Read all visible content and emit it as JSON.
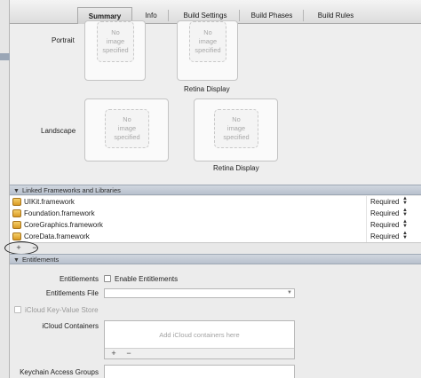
{
  "tabs": [
    {
      "label": "Summary",
      "active": true
    },
    {
      "label": "Info",
      "active": false
    },
    {
      "label": "Build Settings",
      "active": false
    },
    {
      "label": "Build Phases",
      "active": false
    },
    {
      "label": "Build Rules",
      "active": false
    }
  ],
  "launch_images": {
    "portrait_label": "Portrait",
    "landscape_label": "Landscape",
    "retina_label": "Retina Display",
    "no_image_line1": "No",
    "no_image_line2": "image",
    "no_image_line3": "specified"
  },
  "linked_frameworks": {
    "header": "Linked Frameworks and Libraries",
    "items": [
      {
        "name": "UIKit.framework",
        "status": "Required"
      },
      {
        "name": "Foundation.framework",
        "status": "Required"
      },
      {
        "name": "CoreGraphics.framework",
        "status": "Required"
      },
      {
        "name": "CoreData.framework",
        "status": "Required"
      }
    ],
    "add_label": "+",
    "remove_label": "−",
    "stepper_glyph": "▲▼"
  },
  "entitlements": {
    "header": "Entitlements",
    "entitlements_label": "Entitlements",
    "enable_label": "Enable Entitlements",
    "entitlements_file_label": "Entitlements File",
    "entitlements_file_value": "",
    "icloud_kv_label": "iCloud Key-Value Store",
    "icloud_containers_label": "iCloud Containers",
    "icloud_containers_placeholder": "Add iCloud containers here",
    "keychain_label": "Keychain Access Groups",
    "add_label": "+",
    "remove_label": "−"
  },
  "icons": {
    "section_triangle": "▼",
    "select_arrow": "▼",
    "stepper": "▲▼"
  }
}
